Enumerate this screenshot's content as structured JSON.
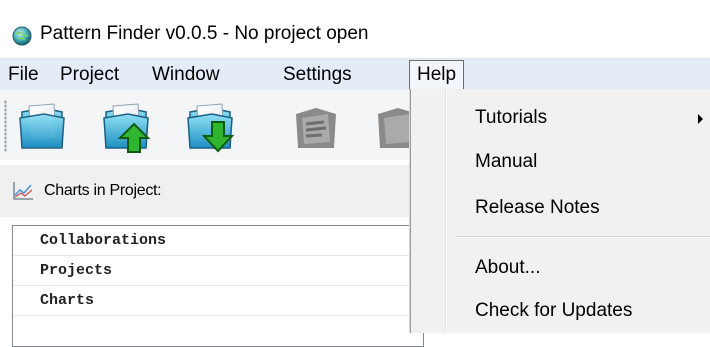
{
  "window": {
    "title": "Pattern Finder v0.0.5 - No project open",
    "icon": "app-globe-icon"
  },
  "menubar": {
    "items": [
      "File",
      "Project",
      "Window",
      "Settings",
      "Help"
    ],
    "active": "Help"
  },
  "toolbar": {
    "buttons": [
      {
        "icon": "open-project-icon",
        "enabled": true
      },
      {
        "icon": "upload-project-icon",
        "enabled": true
      },
      {
        "icon": "download-project-icon",
        "enabled": true
      },
      {
        "icon": "disabled-action-icon",
        "enabled": false
      },
      {
        "icon": "disabled-action-icon",
        "enabled": false
      }
    ]
  },
  "charts_panel": {
    "title": "Charts in Project:",
    "icon": "line-chart-icon",
    "items": [
      "Collaborations",
      "Projects",
      "Charts"
    ]
  },
  "help_menu": {
    "items": [
      {
        "label": "Tutorials",
        "has_submenu": true
      },
      {
        "label": "Manual",
        "has_submenu": false
      },
      {
        "label": "Release Notes",
        "has_submenu": false
      },
      {
        "label": "About...",
        "has_submenu": false
      },
      {
        "label": "Check for Updates",
        "has_submenu": false
      }
    ]
  },
  "colors": {
    "menubar_bg": "#e4ecf7",
    "menu_bg": "#f1f1f1",
    "arrow_green": "#2fb52f"
  }
}
